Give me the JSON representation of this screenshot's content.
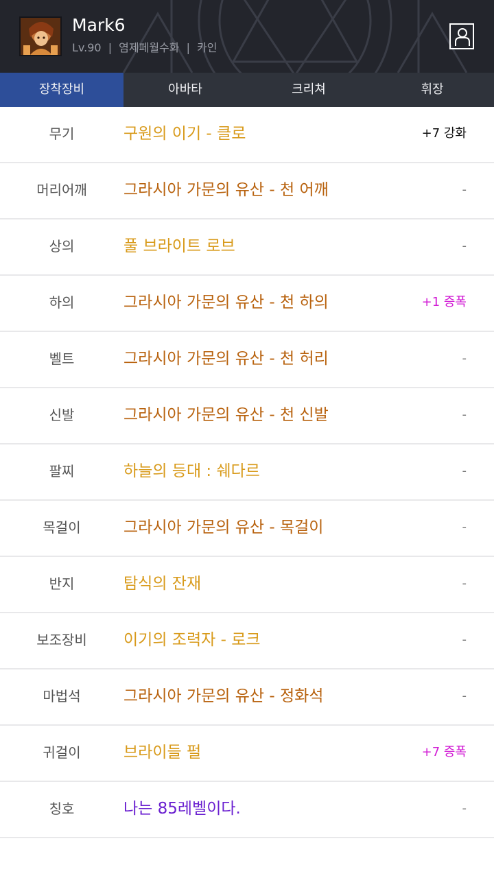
{
  "header": {
    "character_name": "Mark6",
    "level": "Lv.90",
    "server": "염제페월수화",
    "guild": "카인",
    "separator": "|",
    "avatar_icon": "character-portrait",
    "profile_icon": "person-icon"
  },
  "tabs": [
    {
      "label": "장착장비",
      "active": true
    },
    {
      "label": "아바타",
      "active": false
    },
    {
      "label": "크리쳐",
      "active": false
    },
    {
      "label": "휘장",
      "active": false
    }
  ],
  "colors": {
    "unique": "#d89a1a",
    "legendary": "#b8620e",
    "rare": "#6a1fd0",
    "upgrade_normal": "#111111",
    "upgrade_amplify": "#d11ad4",
    "none": "#777777",
    "active_tab": "#2d4e99"
  },
  "equipment": [
    {
      "slot": "무기",
      "item": "구원의 이기 - 클로",
      "rarity": "unique",
      "upgrade": "+7 강화",
      "upgrade_type": "upgrade_normal"
    },
    {
      "slot": "머리어깨",
      "item": "그라시아 가문의 유산 - 천 어깨",
      "rarity": "legendary",
      "upgrade": "-",
      "upgrade_type": "none"
    },
    {
      "slot": "상의",
      "item": "풀 브라이트 로브",
      "rarity": "unique",
      "upgrade": "-",
      "upgrade_type": "none"
    },
    {
      "slot": "하의",
      "item": "그라시아 가문의 유산 - 천 하의",
      "rarity": "legendary",
      "upgrade": "+1 증폭",
      "upgrade_type": "upgrade_amplify"
    },
    {
      "slot": "벨트",
      "item": "그라시아 가문의 유산 - 천 허리",
      "rarity": "legendary",
      "upgrade": "-",
      "upgrade_type": "none"
    },
    {
      "slot": "신발",
      "item": "그라시아 가문의 유산 - 천 신발",
      "rarity": "legendary",
      "upgrade": "-",
      "upgrade_type": "none"
    },
    {
      "slot": "팔찌",
      "item": "하늘의 등대 : 쉐다르",
      "rarity": "unique",
      "upgrade": "-",
      "upgrade_type": "none"
    },
    {
      "slot": "목걸이",
      "item": "그라시아 가문의 유산 - 목걸이",
      "rarity": "legendary",
      "upgrade": "-",
      "upgrade_type": "none"
    },
    {
      "slot": "반지",
      "item": "탐식의 잔재",
      "rarity": "unique",
      "upgrade": "-",
      "upgrade_type": "none"
    },
    {
      "slot": "보조장비",
      "item": "이기의 조력자 - 로크",
      "rarity": "unique",
      "upgrade": "-",
      "upgrade_type": "none"
    },
    {
      "slot": "마법석",
      "item": "그라시아 가문의 유산 - 정화석",
      "rarity": "legendary",
      "upgrade": "-",
      "upgrade_type": "none"
    },
    {
      "slot": "귀걸이",
      "item": "브라이들 펄",
      "rarity": "unique",
      "upgrade": "+7 증폭",
      "upgrade_type": "upgrade_amplify"
    },
    {
      "slot": "칭호",
      "item": "나는 85레벨이다.",
      "rarity": "rare",
      "upgrade": "-",
      "upgrade_type": "none"
    }
  ]
}
